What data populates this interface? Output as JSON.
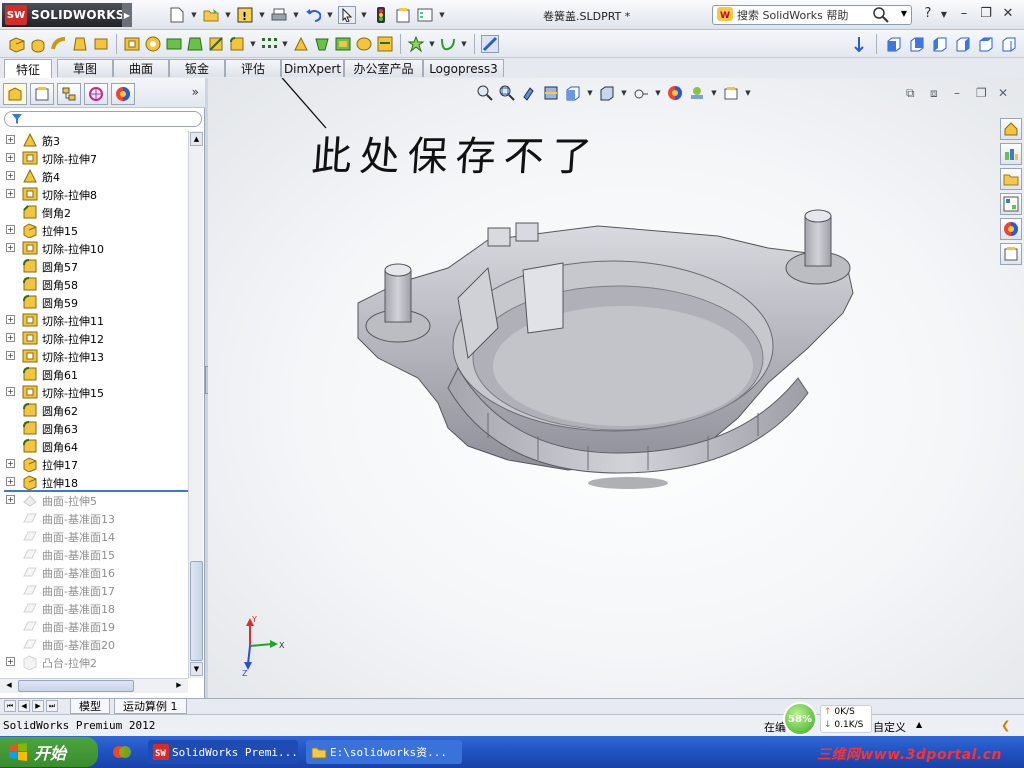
{
  "app": {
    "brand": "SOLIDWORKS",
    "brand_badge": "SW",
    "document_title": "卷簧盖.SLDPRT *"
  },
  "search": {
    "placeholder": "搜索 SolidWorks 帮助"
  },
  "help_glyph": "?",
  "tabs": [
    {
      "label": "特征",
      "active": true
    },
    {
      "label": "草图"
    },
    {
      "label": "曲面"
    },
    {
      "label": "钣金"
    },
    {
      "label": "评估"
    },
    {
      "label": "DimXpert"
    },
    {
      "label": "办公室产品"
    },
    {
      "label": "Logopress3"
    }
  ],
  "tree": [
    {
      "label": "筋3",
      "icon": "rib-icon",
      "expand": "+"
    },
    {
      "label": "切除-拉伸7",
      "icon": "cut-extrude-icon",
      "expand": "+"
    },
    {
      "label": "筋4",
      "icon": "rib-icon",
      "expand": "+"
    },
    {
      "label": "切除-拉伸8",
      "icon": "cut-extrude-icon",
      "expand": "+"
    },
    {
      "label": "倒角2",
      "icon": "chamfer-icon",
      "expand": ""
    },
    {
      "label": "拉伸15",
      "icon": "extrude-icon",
      "expand": "+"
    },
    {
      "label": "切除-拉伸10",
      "icon": "cut-extrude-icon",
      "expand": "+"
    },
    {
      "label": "圆角57",
      "icon": "fillet-icon",
      "expand": ""
    },
    {
      "label": "圆角58",
      "icon": "fillet-icon",
      "expand": ""
    },
    {
      "label": "圆角59",
      "icon": "fillet-icon",
      "expand": ""
    },
    {
      "label": "切除-拉伸11",
      "icon": "cut-extrude-icon",
      "expand": "+"
    },
    {
      "label": "切除-拉伸12",
      "icon": "cut-extrude-icon",
      "expand": "+"
    },
    {
      "label": "切除-拉伸13",
      "icon": "cut-extrude-icon",
      "expand": "+"
    },
    {
      "label": "圆角61",
      "icon": "fillet-icon",
      "expand": ""
    },
    {
      "label": "切除-拉伸15",
      "icon": "cut-extrude-icon",
      "expand": "+"
    },
    {
      "label": "圆角62",
      "icon": "fillet-icon",
      "expand": ""
    },
    {
      "label": "圆角63",
      "icon": "fillet-icon",
      "expand": ""
    },
    {
      "label": "圆角64",
      "icon": "fillet-icon",
      "expand": ""
    },
    {
      "label": "拉伸17",
      "icon": "extrude-icon",
      "expand": "+"
    },
    {
      "label": "拉伸18",
      "icon": "extrude-icon",
      "expand": "+"
    },
    {
      "label": "曲面-拉伸5",
      "icon": "surface-extrude-icon",
      "expand": "+",
      "suppressed": true
    },
    {
      "label": "曲面-基准面13",
      "icon": "planar-surface-icon",
      "expand": "",
      "suppressed": true
    },
    {
      "label": "曲面-基准面14",
      "icon": "planar-surface-icon",
      "expand": "",
      "suppressed": true
    },
    {
      "label": "曲面-基准面15",
      "icon": "planar-surface-icon",
      "expand": "",
      "suppressed": true
    },
    {
      "label": "曲面-基准面16",
      "icon": "planar-surface-icon",
      "expand": "",
      "suppressed": true
    },
    {
      "label": "曲面-基准面17",
      "icon": "planar-surface-icon",
      "expand": "",
      "suppressed": true
    },
    {
      "label": "曲面-基准面18",
      "icon": "planar-surface-icon",
      "expand": "",
      "suppressed": true
    },
    {
      "label": "曲面-基准面19",
      "icon": "planar-surface-icon",
      "expand": "",
      "suppressed": true
    },
    {
      "label": "曲面-基准面20",
      "icon": "planar-surface-icon",
      "expand": "",
      "suppressed": true
    },
    {
      "label": "凸台-拉伸2",
      "icon": "boss-extrude-icon",
      "expand": "+",
      "suppressed": true
    }
  ],
  "annotation": {
    "text": "此处保存不了"
  },
  "triad": {
    "x": "X",
    "y": "Y",
    "z": "Z"
  },
  "bottom_tabs": [
    {
      "label": "模型"
    },
    {
      "label": "运动算例 1"
    }
  ],
  "status": {
    "left": "SolidWorks Premium 2012",
    "editing": "在编",
    "custom": "自定义",
    "net_percent": "58%",
    "upload": "0K/S",
    "download": "0.1K/S"
  },
  "taskbar": {
    "start": "开始",
    "items": [
      {
        "label": "SolidWorks Premi..."
      },
      {
        "label": "E:\\solidworks资..."
      }
    ],
    "watermark": "三维网www.3dportal.cn"
  },
  "colors": {
    "accent": "#3b7ad1",
    "brand_red": "#d42b2b",
    "taskbar_blue": "#2357c6",
    "start_green": "#3a8c2f",
    "model_grey": "#b9bac1"
  }
}
